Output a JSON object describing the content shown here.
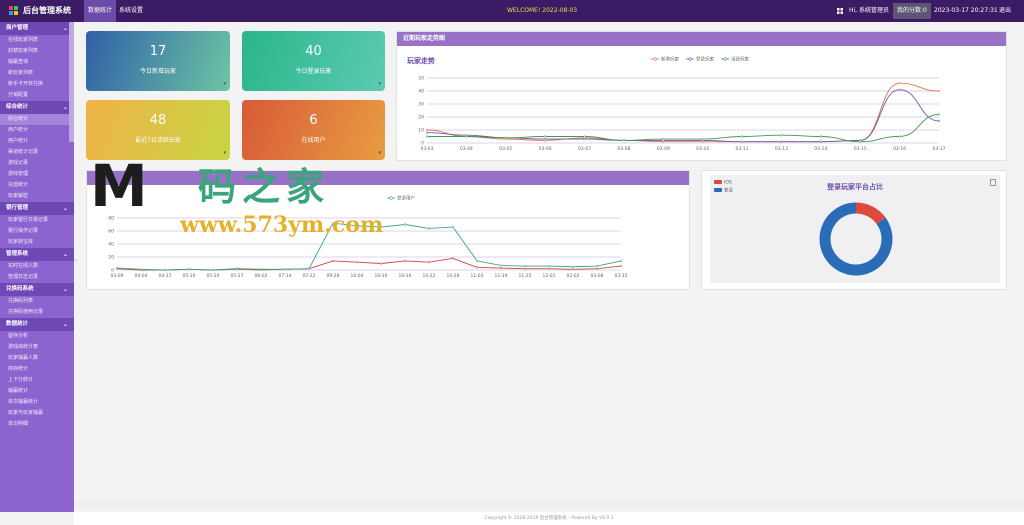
{
  "header": {
    "brand": "后台管理系统",
    "tabs": [
      {
        "label": "数据统计"
      },
      {
        "label": "系统设置"
      }
    ],
    "welcome": "WELCOME! 2022-08-03",
    "greeting": "Hi, 系统管理员",
    "score": "我的分数:0",
    "clock": "2023-03-17 20:27:31",
    "logout": "退出"
  },
  "sidebar": [
    {
      "group": "商户管理",
      "items": [
        "在线玩家列表",
        "封禁玩家列表",
        "输赢查询",
        "新玩家列表",
        "新手卡开奖兑换",
        "分销配置"
      ]
    },
    {
      "group": "综合统计",
      "items": [
        "综合统计",
        "用户统计",
        "用户统计",
        "渠道统计记录",
        "游戏记录",
        "游戏管理",
        "充值统计",
        "玩家解密"
      ]
    },
    {
      "group": "银行管理",
      "items": [
        "玩家银行交易记录",
        "银行操作记录",
        "玩家转宝库"
      ]
    },
    {
      "group": "管理系统",
      "items": [
        "实时在线人数",
        "管理日志记录"
      ]
    },
    {
      "group": "兑换码系统",
      "items": [
        "兑换码列表",
        "兑换码使用记录"
      ]
    },
    {
      "group": "数据统计",
      "items": [
        "留存分析",
        "游戏库统计表",
        "玩家输赢人数",
        "库存统计",
        "上下分统计",
        "输赢统计",
        "单次输赢统计",
        "玩家与玩家输赢",
        "单次明细"
      ]
    }
  ],
  "stats": [
    {
      "value": "17",
      "label": "今日新增玩家"
    },
    {
      "value": "40",
      "label": "今日登录玩家"
    },
    {
      "value": "48",
      "label": "最近7日活跃玩家"
    },
    {
      "value": "6",
      "label": "在线用户"
    }
  ],
  "panels": {
    "trend": {
      "head": "近期玩家走势图",
      "title": "玩家走势"
    },
    "online": {
      "head": ""
    },
    "platform": {
      "head": "",
      "title": "登录玩家平台占比"
    }
  },
  "watermark": {
    "m": "M",
    "cn": "码之家",
    "url": "www.573ym.com"
  },
  "footer": "Copyright © 2018-2019 后台管理系统 - Powered By V6.0.1",
  "colors": {
    "topbar": "#3b1c64",
    "sidebar": "#8c63cf",
    "accent": "#9772c7"
  },
  "chart_data": [
    {
      "type": "line",
      "title": "玩家走势",
      "x": [
        "03-03",
        "03-04",
        "03-05",
        "03-06",
        "03-07",
        "03-08",
        "03-09",
        "03-10",
        "03-11",
        "03-13",
        "03-14",
        "03-15",
        "03-16",
        "03-17"
      ],
      "ylim": [
        0,
        50
      ],
      "yticks": [
        0,
        10,
        20,
        30,
        40,
        50
      ],
      "legend_position": "top-right",
      "series": [
        {
          "name": "新增玩家",
          "color": "#e8734d",
          "values": [
            10,
            5,
            3,
            2,
            4,
            2,
            1,
            1,
            1,
            1,
            1,
            2,
            46,
            40
          ]
        },
        {
          "name": "登录玩家",
          "color": "#6e5aa8",
          "values": [
            8,
            6,
            4,
            3,
            3,
            2,
            2,
            2,
            1,
            1,
            1,
            2,
            41,
            17
          ]
        },
        {
          "name": "活跃玩家",
          "color": "#3b9a4c",
          "values": [
            5,
            5,
            4,
            5,
            5,
            2,
            3,
            3,
            5,
            6,
            5,
            1,
            5,
            22
          ]
        }
      ]
    },
    {
      "type": "line",
      "x": [
        "03-09",
        "04-04",
        "04-17",
        "05-10",
        "05-20",
        "05-27",
        "06-02",
        "07-14",
        "07-22",
        "09-28",
        "10-04",
        "10-10",
        "10-16",
        "10-22",
        "10-28",
        "11-03",
        "11-19",
        "11-25",
        "12-01",
        "02-02",
        "03-08",
        "03-15"
      ],
      "ylim": [
        0,
        80
      ],
      "yticks": [
        0,
        20,
        40,
        60,
        80
      ],
      "legend_position": "top-right",
      "series": [
        {
          "name": "",
          "color": "#c9463f",
          "values": [
            2,
            0,
            0,
            1,
            0,
            2,
            1,
            1,
            2,
            14,
            12,
            10,
            14,
            12,
            18,
            4,
            3,
            2,
            2,
            1,
            2,
            6
          ]
        },
        {
          "name": "登录用户",
          "color": "#3aa28c",
          "values": [
            3,
            1,
            0,
            1,
            0,
            1,
            0,
            1,
            2,
            72,
            68,
            66,
            70,
            64,
            66,
            14,
            7,
            6,
            6,
            5,
            6,
            14
          ]
        }
      ]
    },
    {
      "type": "pie",
      "title": "登录玩家平台占比",
      "legend_position": "top-left",
      "slices": [
        {
          "name": "IOS",
          "color": "#dd4a3d",
          "value": 15
        },
        {
          "name": "安卓",
          "color": "#2a6cb7",
          "value": 85
        }
      ]
    }
  ]
}
